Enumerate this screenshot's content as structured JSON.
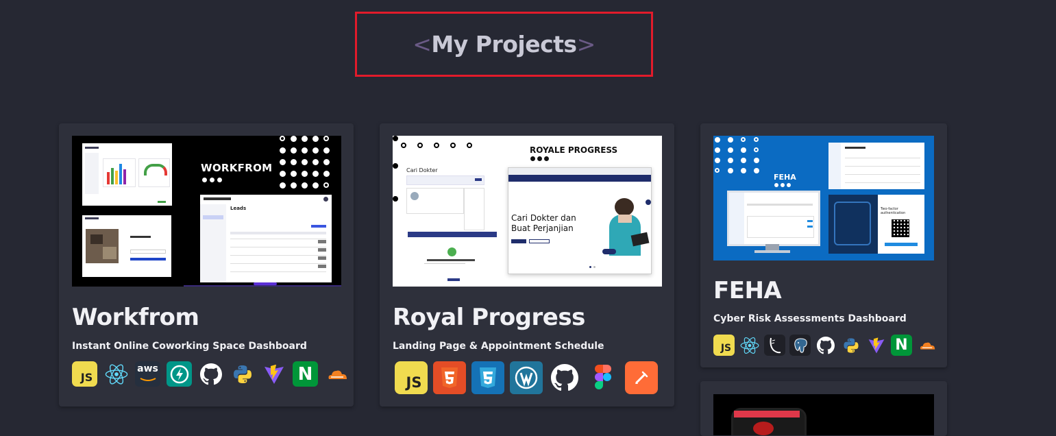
{
  "section": {
    "title": "My Projects",
    "open_bracket": "<",
    "close_bracket": ">"
  },
  "projects": [
    {
      "title": "Workfrom",
      "subtitle": "Instant Online Coworking Space Dashboard",
      "thumbnail": {
        "brand": "WORKFROM",
        "app_heading": "Leads"
      },
      "stack": [
        "javascript-icon",
        "react-icon",
        "aws-icon",
        "fastapi-icon",
        "github-icon",
        "python-icon",
        "vite-icon",
        "nginx-icon",
        "cloudflare-icon"
      ]
    },
    {
      "title": "Royal Progress",
      "subtitle": "Landing Page & Appointment Schedule",
      "thumbnail": {
        "brand": "ROYALE PROGRESS",
        "hero_text": "Cari Dokter dan Buat Perjanjian",
        "side_heading": "Cari Dokter"
      },
      "stack": [
        "javascript-icon",
        "html5-icon",
        "css3-icon",
        "wordpress-icon",
        "github-icon",
        "figma-icon",
        "postman-icon"
      ]
    },
    {
      "title": "FEHA",
      "subtitle": "Cyber Risk Assessments Dashboard",
      "thumbnail": {
        "brand": "FEHA",
        "auth_text": "Two-factor authentication"
      },
      "stack": [
        "javascript-icon",
        "react-icon",
        "flask-icon",
        "postgresql-icon",
        "github-icon",
        "python-icon",
        "vite-icon",
        "nginx-icon",
        "cloudflare-icon"
      ]
    }
  ],
  "icon_text": {
    "js": "JS",
    "aws": "aws",
    "nginx": "N"
  },
  "colors": {
    "background": "#262833",
    "card": "#2e303b",
    "highlight": "#e21b2b",
    "feha_blue": "#0b6bc2",
    "royal_orange": "#e44d26"
  }
}
